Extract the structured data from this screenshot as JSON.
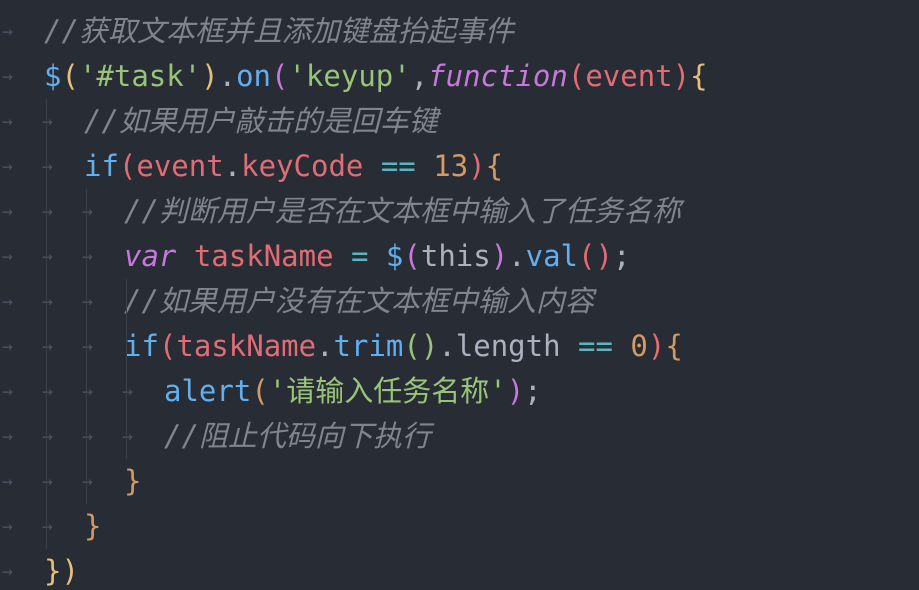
{
  "editor": {
    "lines": [
      {
        "indent": 1,
        "tokens": [
          {
            "t": "//获取文本框并且添加键盘抬起事件",
            "c": "cm"
          }
        ]
      },
      {
        "indent": 1,
        "tokens": [
          {
            "t": "$",
            "c": "fn"
          },
          {
            "t": "(",
            "c": "b1"
          },
          {
            "t": "'#task'",
            "c": "st"
          },
          {
            "t": ")",
            "c": "b1"
          },
          {
            "t": ".",
            "c": "pl"
          },
          {
            "t": "on",
            "c": "fn"
          },
          {
            "t": "(",
            "c": "b2"
          },
          {
            "t": "'keyup'",
            "c": "st"
          },
          {
            "t": ",",
            "c": "pl"
          },
          {
            "t": "function",
            "c": "kwi"
          },
          {
            "t": "(",
            "c": "b4"
          },
          {
            "t": "event",
            "c": "vr"
          },
          {
            "t": ")",
            "c": "b4"
          },
          {
            "t": "{",
            "c": "b1"
          }
        ]
      },
      {
        "indent": 2,
        "tokens": [
          {
            "t": "//如果用户敲击的是回车键",
            "c": "cm"
          }
        ]
      },
      {
        "indent": 2,
        "tokens": [
          {
            "t": "if",
            "c": "fn"
          },
          {
            "t": "(",
            "c": "b4"
          },
          {
            "t": "event",
            "c": "vr"
          },
          {
            "t": ".",
            "c": "pl"
          },
          {
            "t": "keyCode",
            "c": "vr"
          },
          {
            "t": " == ",
            "c": "op"
          },
          {
            "t": "13",
            "c": "nm"
          },
          {
            "t": ")",
            "c": "b4"
          },
          {
            "t": "{",
            "c": "b5"
          }
        ]
      },
      {
        "indent": 3,
        "tokens": [
          {
            "t": "//判断用户是否在文本框中输入了任务名称",
            "c": "cm"
          }
        ]
      },
      {
        "indent": 3,
        "tokens": [
          {
            "t": "var",
            "c": "kwi"
          },
          {
            "t": " taskName ",
            "c": "vr"
          },
          {
            "t": "=",
            "c": "op"
          },
          {
            "t": " $",
            "c": "fn"
          },
          {
            "t": "(",
            "c": "b2"
          },
          {
            "t": "this",
            "c": "pl"
          },
          {
            "t": ")",
            "c": "b2"
          },
          {
            "t": ".",
            "c": "pl"
          },
          {
            "t": "val",
            "c": "fn"
          },
          {
            "t": "()",
            "c": "b4"
          },
          {
            "t": ";",
            "c": "pl"
          }
        ]
      },
      {
        "indent": 3,
        "tokens": [
          {
            "t": "//如果用户没有在文本框中输入内容",
            "c": "cm"
          }
        ]
      },
      {
        "indent": 3,
        "tokens": [
          {
            "t": "if",
            "c": "fn"
          },
          {
            "t": "(",
            "c": "b4"
          },
          {
            "t": "taskName",
            "c": "vr"
          },
          {
            "t": ".",
            "c": "pl"
          },
          {
            "t": "trim",
            "c": "fn"
          },
          {
            "t": "()",
            "c": "gr"
          },
          {
            "t": ".",
            "c": "pl"
          },
          {
            "t": "length",
            "c": "pl"
          },
          {
            "t": " == ",
            "c": "op"
          },
          {
            "t": "0",
            "c": "nm"
          },
          {
            "t": ")",
            "c": "b4"
          },
          {
            "t": "{",
            "c": "b5"
          }
        ]
      },
      {
        "indent": 4,
        "tokens": [
          {
            "t": "alert",
            "c": "fn"
          },
          {
            "t": "(",
            "c": "b5"
          },
          {
            "t": "'请输入任务名称'",
            "c": "st"
          },
          {
            "t": ")",
            "c": "b2"
          },
          {
            "t": ";",
            "c": "pl"
          }
        ]
      },
      {
        "indent": 4,
        "tokens": [
          {
            "t": "//阻止代码向下执行",
            "c": "cm"
          }
        ]
      },
      {
        "indent": 3,
        "tokens": [
          {
            "t": "}",
            "c": "b5"
          }
        ]
      },
      {
        "indent": 2,
        "tokens": [
          {
            "t": "}",
            "c": "b5"
          }
        ]
      },
      {
        "indent": 1,
        "tokens": [
          {
            "t": "})",
            "c": "b1"
          }
        ]
      }
    ],
    "tab_glyph": "→",
    "colors": {
      "background": "#282c34",
      "comment": "#7f848e",
      "keyword": "#c678dd",
      "function": "#61afef",
      "string": "#98c379",
      "variable": "#e06c75",
      "number": "#d19a66",
      "operator": "#56b6c2",
      "bracket": "#e5c07b",
      "tab_marker": "#4b5263"
    }
  }
}
